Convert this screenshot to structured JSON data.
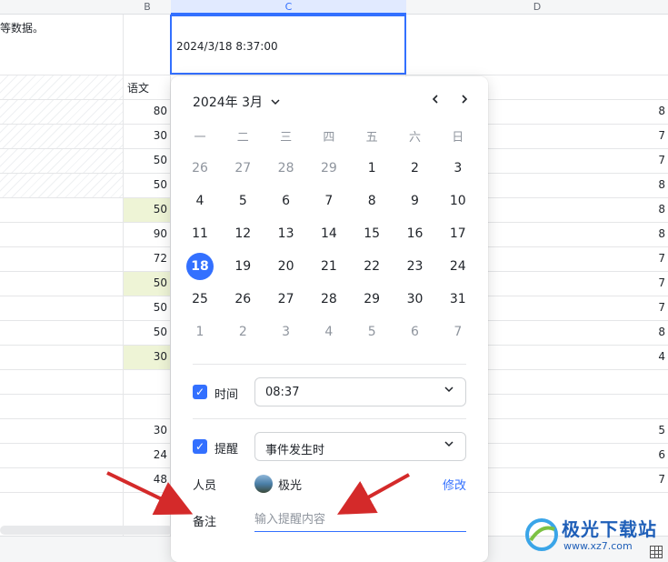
{
  "columns": {
    "b": "B",
    "c": "C",
    "d": "D"
  },
  "cells": {
    "a1": "等数据。",
    "c1": "2024/3/18 8:37:00",
    "b_header": "语文"
  },
  "b_values": [
    "80",
    "30",
    "50",
    "50",
    "50",
    "90",
    "72",
    "50",
    "50",
    "50",
    "30",
    "",
    "",
    "30",
    "24",
    "48"
  ],
  "d_values": [
    "8",
    "7",
    "7",
    "8",
    "8",
    "8",
    "7",
    "7",
    "7",
    "8",
    "4",
    "",
    "",
    "5",
    "6",
    "7"
  ],
  "calendar": {
    "month_label": "2024年 3月",
    "prev_icon": "chevron-left-icon",
    "next_icon": "chevron-right-icon",
    "weekdays": [
      "一",
      "二",
      "三",
      "四",
      "五",
      "六",
      "日"
    ],
    "weeks": [
      [
        "26",
        "27",
        "28",
        "29",
        "1",
        "2",
        "3"
      ],
      [
        "4",
        "5",
        "6",
        "7",
        "8",
        "9",
        "10"
      ],
      [
        "11",
        "12",
        "13",
        "14",
        "15",
        "16",
        "17"
      ],
      [
        "18",
        "19",
        "20",
        "21",
        "22",
        "23",
        "24"
      ],
      [
        "25",
        "26",
        "27",
        "28",
        "29",
        "30",
        "31"
      ],
      [
        "1",
        "2",
        "3",
        "4",
        "5",
        "6",
        "7"
      ]
    ],
    "selected_day": "18"
  },
  "time": {
    "label": "时间",
    "value": "08:37",
    "checked": true
  },
  "reminder": {
    "label": "提醒",
    "value": "事件发生时",
    "checked": true
  },
  "person": {
    "label": "人员",
    "name": "极光",
    "action": "修改"
  },
  "note": {
    "label": "备注",
    "placeholder": "输入提醒内容"
  },
  "watermark": {
    "text": "极光下载站",
    "url": "www.xz7.com"
  },
  "colors": {
    "accent": "#3370ff",
    "highlight": "#eef4d6",
    "arrow": "#d42a2a"
  }
}
